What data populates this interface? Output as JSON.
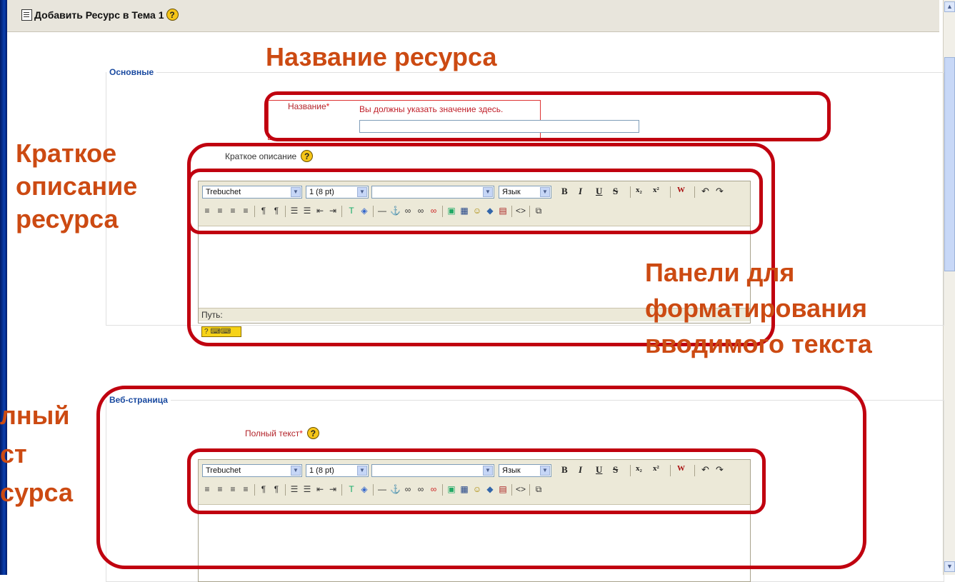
{
  "window": {
    "title": "Добавить Ресурс в Тема 1"
  },
  "section_main": {
    "legend": "Основные",
    "name_label": "Название",
    "name_error": "Вы должны указать значение здесь.",
    "name_value": "",
    "summary_label": "Краткое описание"
  },
  "section_web": {
    "legend": "Веб-страница",
    "fulltext_label": "Полный текст"
  },
  "editor": {
    "font": "Trebuchet",
    "size": "1 (8 pt)",
    "style": "",
    "lang": "Язык",
    "path_label": "Путь:"
  },
  "annotations": {
    "title": "Название ресурса",
    "summary_1": "Краткое",
    "summary_2": "описание",
    "summary_3": "ресурса",
    "panels_1": "Панели для",
    "panels_2": "форматирования",
    "panels_3": "вводимого текста",
    "full_1": "лный",
    "full_2": "ст",
    "full_3": "сурса"
  },
  "colors": {
    "annotation": "#cc4a12",
    "highlight": "#c0000f",
    "legend": "#1a4aa0"
  }
}
